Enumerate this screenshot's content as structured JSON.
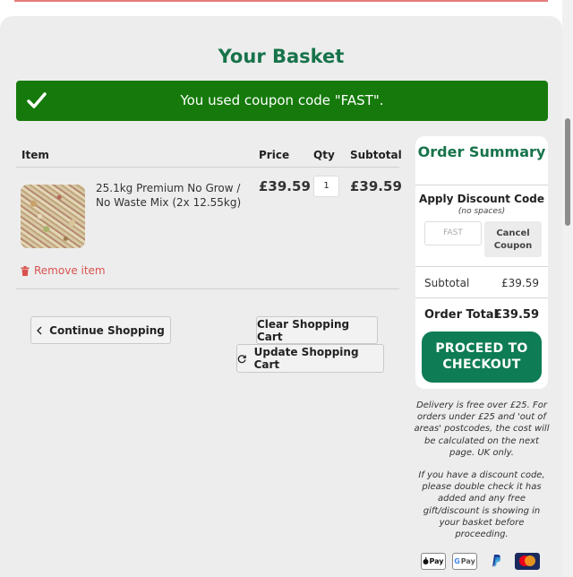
{
  "page": {
    "title": "Your Basket"
  },
  "coupon_banner": {
    "message": "You used coupon code \"FAST\"."
  },
  "cart": {
    "columns": [
      "Item",
      "Price",
      "Qty",
      "Subtotal"
    ],
    "items": [
      {
        "name": "25.1kg Premium No Grow / No Waste Mix (2x 12.55kg)",
        "price": "£39.59",
        "qty": "1",
        "subtotal": "£39.59"
      }
    ],
    "remove_label": "Remove item"
  },
  "actions": {
    "continue_shopping": "Continue Shopping",
    "clear_cart": "Clear Shopping Cart",
    "update_cart": "Update Shopping Cart"
  },
  "summary": {
    "title": "Order Summary",
    "discount_label": "Apply Discount Code",
    "discount_hint": "(no spaces)",
    "discount_code_value": "FAST",
    "cancel_coupon": "Cancel Coupon",
    "subtotal_label": "Subtotal",
    "subtotal_value": "£39.59",
    "total_label": "Order Total",
    "total_value": "£39.59",
    "checkout_label": "PROCEED TO CHECKOUT"
  },
  "notes": {
    "delivery": "Delivery is free over £25. For orders under £25 and 'out of areas' postcodes, the cost will be calculated on the next page. UK only.",
    "discount": "If you have a discount code, please double check it has added and any free gift/discount is showing in your basket before proceeding."
  },
  "payment_methods": [
    "Apple Pay",
    "Google Pay",
    "PayPal",
    "MasterCard"
  ],
  "colors": {
    "brand_green": "#17734a",
    "banner_green": "#157a0b",
    "checkout_green": "#0e7c55",
    "remove_red": "#d9534f"
  }
}
